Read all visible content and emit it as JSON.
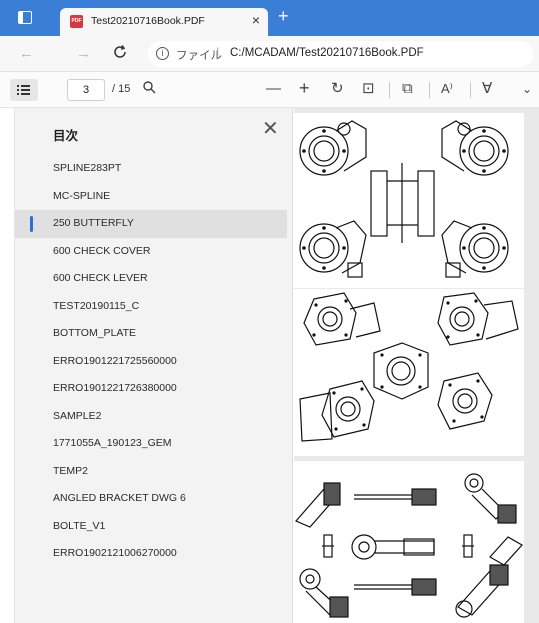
{
  "tab": {
    "title": "Test20210716Book.PDF",
    "close_glyph": "×",
    "new_tab_glyph": "+"
  },
  "nav": {
    "back_glyph": "←",
    "forward_glyph": "→",
    "refresh_glyph": "C",
    "info_glyph": "i",
    "scheme_label": "ファイル",
    "separator": "|",
    "url": "C:/MCADAM/Test20210716Book.PDF"
  },
  "toolbar": {
    "current_page": "3",
    "total_pages": "/ 15",
    "search_glyph": "⚲",
    "zoom_out_glyph": "—",
    "zoom_in_glyph": "+",
    "rotate_glyph": "↻",
    "fit_glyph": "⊡",
    "two_page_glyph": "⧉",
    "read_aloud_glyph": "A⁾",
    "draw_glyph": "∀",
    "more_glyph": "⌄"
  },
  "toc": {
    "title": "目次",
    "close_glyph": "✕",
    "items": [
      "SPLINE283PT",
      "MC-SPLINE",
      "250 BUTTERFLY",
      "600 CHECK COVER",
      "600 CHECK LEVER",
      "TEST20190115_C",
      "BOTTOM_PLATE",
      "ERRO1901221725560000",
      "ERRO1901221726380000",
      "SAMPLE2",
      "1771055A_190123_GEM",
      "TEMP2",
      "ANGLED BRACKET DWG 6",
      "BOLTE_V1",
      "ERRO1902121006270000"
    ],
    "active_index": 2
  },
  "colors": {
    "tabstrip": "#3a7fd5",
    "active_marker": "#2a6fd3"
  }
}
